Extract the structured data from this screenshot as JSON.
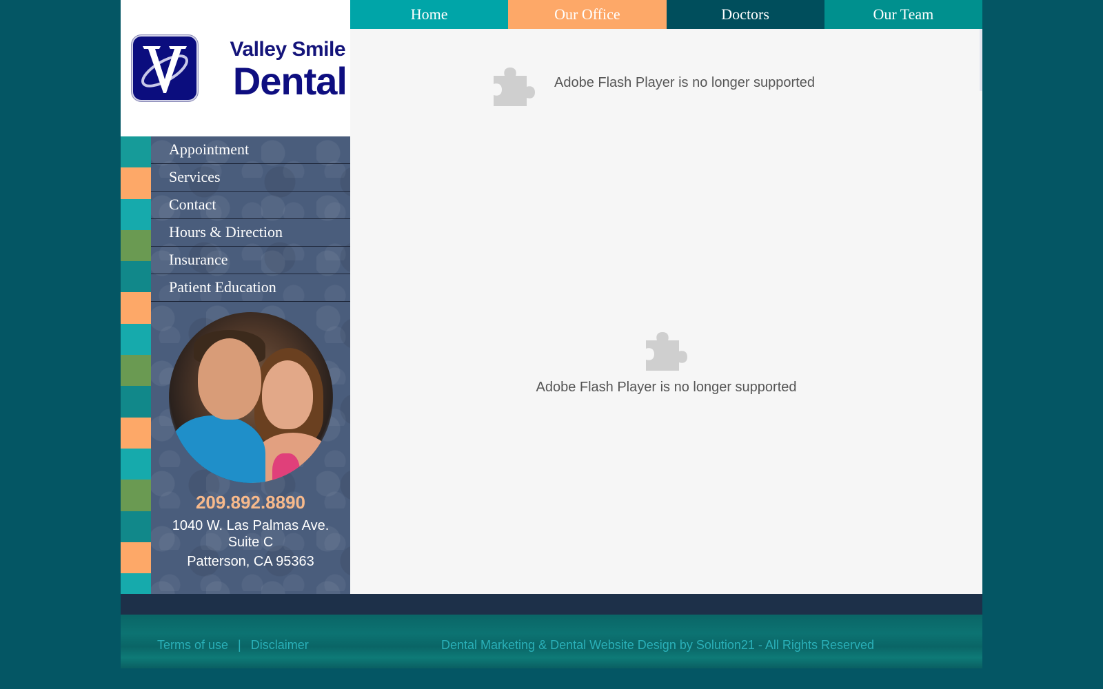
{
  "logo": {
    "line1": "Valley Smile",
    "line2": "Dental"
  },
  "top_nav": [
    {
      "label": "Home",
      "color": "#00a5a8"
    },
    {
      "label": "Our Office",
      "color": "#fda868"
    },
    {
      "label": "Doctors",
      "color": "#004e5c"
    },
    {
      "label": "Our Team",
      "color": "#00908e"
    }
  ],
  "side_menu": [
    {
      "label": "Appointment"
    },
    {
      "label": "Services"
    },
    {
      "label": "Contact"
    },
    {
      "label": "Hours & Direction"
    },
    {
      "label": "Insurance"
    },
    {
      "label": "Patient Education"
    }
  ],
  "contact": {
    "phone": "209.892.8890",
    "address_line1": "1040 W. Las Palmas Ave.",
    "address_line2": "Suite C",
    "address_line3": "Patterson, CA 95363"
  },
  "main": {
    "flash_message_1": "Adobe Flash Player is no longer supported",
    "flash_message_2": "Adobe Flash Player is no longer supported"
  },
  "footer": {
    "terms": "Terms of use",
    "separator": "|",
    "disclaimer": "Disclaimer",
    "credit": "Dental Marketing & Dental Website Design by Solution21 - All Rights Reserved"
  },
  "stripe_colors": [
    "#169b99",
    "#fda868",
    "#16aaac",
    "#6a9a52",
    "#11888a",
    "#fda868",
    "#16aaac",
    "#6a9a52",
    "#11888a",
    "#fda868",
    "#16aaac",
    "#6a9a52",
    "#11888a",
    "#fda868",
    "#16aaac"
  ],
  "theme": {
    "background": "#045664",
    "sidebar": "#4a5d7c",
    "phone_color": "#f7b98b",
    "footer_link": "#2ab0b8"
  }
}
